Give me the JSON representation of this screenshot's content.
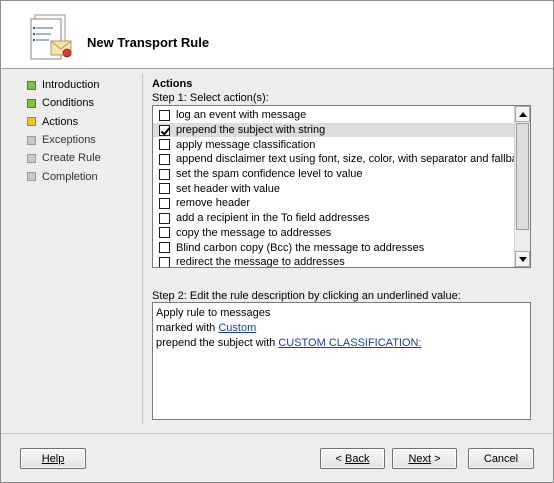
{
  "wizard": {
    "title": "New Transport Rule",
    "steps": [
      {
        "label": "Introduction",
        "state": "done"
      },
      {
        "label": "Conditions",
        "state": "done"
      },
      {
        "label": "Actions",
        "state": "current"
      },
      {
        "label": "Exceptions",
        "state": "todo"
      },
      {
        "label": "Create Rule",
        "state": "todo"
      },
      {
        "label": "Completion",
        "state": "todo"
      }
    ]
  },
  "main": {
    "section_title": "Actions",
    "step1_label": "Step 1: Select action(s):",
    "actions": [
      {
        "label": "log an event with message",
        "checked": false
      },
      {
        "label": "prepend the subject with string",
        "checked": true
      },
      {
        "label": "apply message classification",
        "checked": false
      },
      {
        "label": "append disclaimer text using font, size, color, with separator and fallback to action if unable to apply",
        "checked": false
      },
      {
        "label": "set the spam confidence level to value",
        "checked": false
      },
      {
        "label": "set header with value",
        "checked": false
      },
      {
        "label": "remove header",
        "checked": false
      },
      {
        "label": "add a recipient in the To field addresses",
        "checked": false
      },
      {
        "label": "copy the message to addresses",
        "checked": false
      },
      {
        "label": "Blind carbon copy (Bcc) the message to addresses",
        "checked": false
      },
      {
        "label": "redirect the message to addresses",
        "checked": false
      }
    ],
    "step2_label": "Step 2: Edit the rule description by clicking an underlined value:",
    "description": {
      "line1": "Apply rule to messages",
      "line2_prefix": "marked with ",
      "line2_link": "Custom",
      "line3_prefix": "prepend the subject with ",
      "line3_link": "CUSTOM CLASSIFICATION:"
    }
  },
  "buttons": {
    "help": "Help",
    "back": "Back",
    "next": "Next",
    "cancel": "Cancel"
  },
  "colors": {
    "step_done": "#7dc242",
    "step_current": "#f2c12e",
    "step_todo": "#c8c8c8",
    "link": "#1a3ea6"
  }
}
